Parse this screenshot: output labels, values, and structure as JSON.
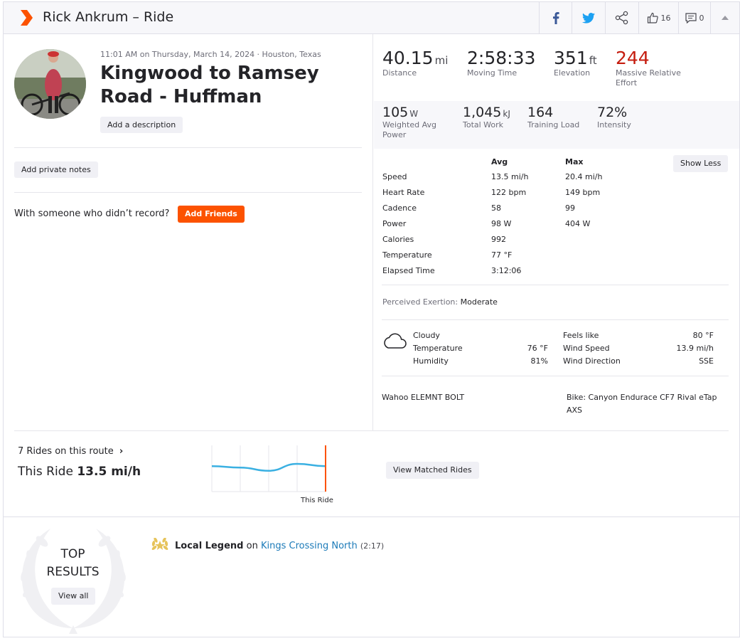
{
  "header": {
    "title": "Rick Ankrum – Ride",
    "kudos_count": "16",
    "comment_count": "0"
  },
  "activity": {
    "meta": "11:01 AM on Thursday, March 14, 2024 · Houston, Texas",
    "title": "Kingwood to Ramsey Road - Huffman",
    "add_description": "Add a description",
    "add_private_notes": "Add private notes",
    "with_someone": "With someone who didn’t record?",
    "add_friends": "Add Friends"
  },
  "primary_stats": [
    {
      "value": "40.15",
      "unit": "mi",
      "label": "Distance"
    },
    {
      "value": "2:58:33",
      "unit": "",
      "label": "Moving Time"
    },
    {
      "value": "351",
      "unit": "ft",
      "label": "Elevation"
    },
    {
      "value": "244",
      "unit": "",
      "label": "Massive Relative Effort"
    }
  ],
  "secondary_stats": [
    {
      "value": "105",
      "unit": "W",
      "label": "Weighted Avg Power"
    },
    {
      "value": "1,045",
      "unit": "kJ",
      "label": "Total Work"
    },
    {
      "value": "164",
      "unit": "",
      "label": "Training Load"
    },
    {
      "value": "72%",
      "unit": "",
      "label": "Intensity"
    }
  ],
  "details": {
    "avg_header": "Avg",
    "max_header": "Max",
    "show_less": "Show Less",
    "rows": [
      {
        "label": "Speed",
        "avg": "13.5 mi/h",
        "max": "20.4 mi/h"
      },
      {
        "label": "Heart Rate",
        "avg": "122 bpm",
        "max": "149 bpm"
      },
      {
        "label": "Cadence",
        "avg": "58",
        "max": "99"
      },
      {
        "label": "Power",
        "avg": "98 W",
        "max": "404 W"
      },
      {
        "label": "Calories",
        "avg": "992",
        "max": ""
      },
      {
        "label": "Temperature",
        "avg": "77 °F",
        "max": ""
      },
      {
        "label": "Elapsed Time",
        "avg": "3:12:06",
        "max": ""
      }
    ]
  },
  "perceived_exertion": {
    "label": "Perceived Exertion:",
    "value": "Moderate"
  },
  "weather": {
    "condition": "Cloudy",
    "temperature_label": "Temperature",
    "temperature": "76 °F",
    "humidity_label": "Humidity",
    "humidity": "81%",
    "feels_like_label": "Feels like",
    "feels_like": "80 °F",
    "wind_speed_label": "Wind Speed",
    "wind_speed": "13.9 mi/h",
    "wind_direction_label": "Wind Direction",
    "wind_direction": "SSE",
    "icon": "cloud-icon"
  },
  "gear": {
    "device": "Wahoo ELEMNT BOLT",
    "bike_line1": "Bike: Canyon Endurace CF7 Rival eTap",
    "bike_line2": "AXS"
  },
  "route": {
    "rides_on_route": "7 Rides on this route",
    "this_ride_prefix": "This Ride",
    "this_ride_speed": "13.5 mi/h",
    "this_ride_marker": "This Ride",
    "view_matched": "View Matched Rides",
    "speeds_relative": [
      0.55,
      0.52,
      0.45,
      0.6,
      0.55
    ]
  },
  "top_results": {
    "title_line1": "TOP",
    "title_line2": "RESULTS",
    "view_all": "View all",
    "achievement": "Local Legend",
    "on": "on",
    "segment": "Kings Crossing North",
    "count": "(2:17)"
  },
  "colors": {
    "brand": "#fc5200",
    "effort_red": "#c51d0f",
    "facebook": "#3b5998",
    "twitter": "#1da1f2",
    "link": "#1b7ab8",
    "sparkline": "#3ab0e2"
  }
}
